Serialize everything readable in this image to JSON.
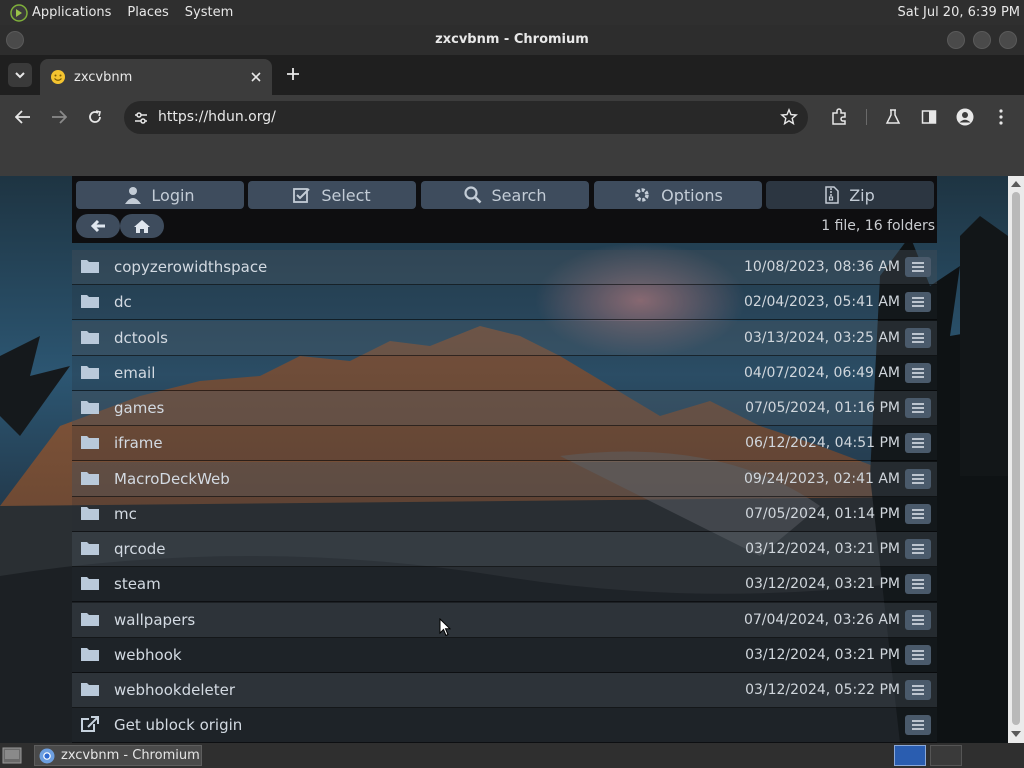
{
  "desktop": {
    "menus": [
      "Applications",
      "Places",
      "System"
    ],
    "clock": "Sat Jul 20,  6:39 PM"
  },
  "window": {
    "title": "zxcvbnm - Chromium"
  },
  "browser": {
    "tab_title": "zxcvbnm",
    "url": "https://hdun.org/"
  },
  "filemanager": {
    "nav_buttons": [
      {
        "label": "Login",
        "icon": "user-icon"
      },
      {
        "label": "Select",
        "icon": "checkbox-icon"
      },
      {
        "label": "Search",
        "icon": "search-icon"
      },
      {
        "label": "Options",
        "icon": "gear-icon"
      },
      {
        "label": "Zip",
        "icon": "zip-file-icon"
      }
    ],
    "count_text": "1 file, 16 folders",
    "rows": [
      {
        "name": "copyzerowidthspace",
        "date": "10/08/2023, 08:36 AM",
        "type": "folder"
      },
      {
        "name": "dc",
        "date": "02/04/2023, 05:41 AM",
        "type": "folder"
      },
      {
        "name": "dctools",
        "date": "03/13/2024, 03:25 AM",
        "type": "folder"
      },
      {
        "name": "email",
        "date": "04/07/2024, 06:49 AM",
        "type": "folder"
      },
      {
        "name": "games",
        "date": "07/05/2024, 01:16 PM",
        "type": "folder"
      },
      {
        "name": "iframe",
        "date": "06/12/2024, 04:51 PM",
        "type": "folder"
      },
      {
        "name": "MacroDeckWeb",
        "date": "09/24/2023, 02:41 AM",
        "type": "folder"
      },
      {
        "name": "mc",
        "date": "07/05/2024, 01:14 PM",
        "type": "folder"
      },
      {
        "name": "qrcode",
        "date": "03/12/2024, 03:21 PM",
        "type": "folder"
      },
      {
        "name": "steam",
        "date": "03/12/2024, 03:21 PM",
        "type": "folder"
      },
      {
        "name": "wallpapers",
        "date": "07/04/2024, 03:26 AM",
        "type": "folder"
      },
      {
        "name": "webhook",
        "date": "03/12/2024, 03:21 PM",
        "type": "folder"
      },
      {
        "name": "webhookdeleter",
        "date": "03/12/2024, 05:22 PM",
        "type": "folder"
      },
      {
        "name": "Get ublock origin",
        "date": "",
        "type": "link"
      }
    ]
  },
  "taskbar": {
    "task_label": "zxcvbnm - Chromium"
  },
  "colors": {
    "nav_button": "#3e4c5d",
    "panel": "#0e0e10",
    "row_text": "#d3dae2",
    "chrome_toolbar": "#3c3c3c"
  }
}
